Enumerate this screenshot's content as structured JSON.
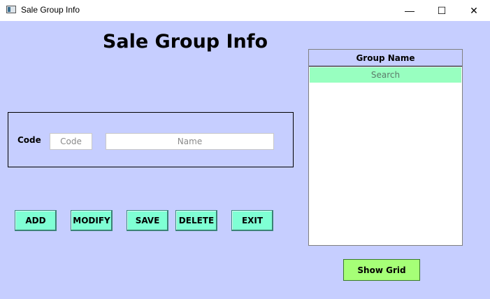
{
  "window": {
    "title": "Sale Group Info",
    "minimize_glyph": "—",
    "maximize_glyph": "☐",
    "close_glyph": "✕"
  },
  "form": {
    "heading": "Sale Group Info",
    "code_label": "Code",
    "code_placeholder": "Code",
    "name_placeholder": "Name"
  },
  "buttons": {
    "add": "ADD",
    "modify": "MODIFY",
    "save": "SAVE",
    "delete": "DELETE",
    "exit": "EXIT",
    "show_grid": "Show Grid"
  },
  "grid": {
    "column_header": "Group Name",
    "search_placeholder": "Search",
    "rows": []
  },
  "colors": {
    "background": "#c6ceff",
    "action_button": "#7fffd4",
    "search_row": "#98ffc0",
    "show_grid_button": "#a6ff77"
  }
}
